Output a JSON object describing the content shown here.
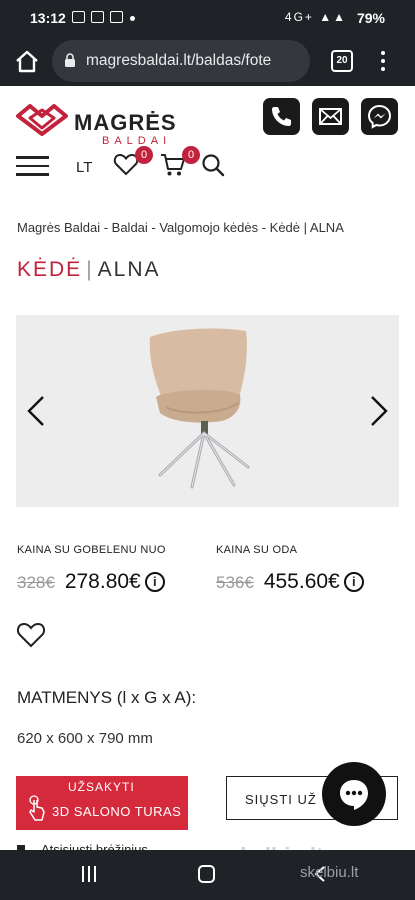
{
  "status_bar": {
    "time": "13:12",
    "battery": "79%",
    "signal": "4G+"
  },
  "browser": {
    "url": "magresbaldai.lt/baldas/fote",
    "tab_count": "20"
  },
  "header": {
    "brand": "MAGRĖS",
    "brand_sub": "BALDAI",
    "language": "LT",
    "wishlist_count": "0",
    "cart_count": "0",
    "icons": [
      "phone-icon",
      "mail-icon",
      "messenger-icon",
      "menu-icon",
      "heart-icon",
      "cart-icon",
      "search-icon"
    ]
  },
  "breadcrumb": "Magrės Baldai - Baldai - Valgomojo kėdės - Kėdė | ALNA",
  "product": {
    "title_part1": "KĖDĖ",
    "title_sep": "|",
    "title_part2": "ALNA"
  },
  "prices": [
    {
      "label": "KAINA SU GOBELENU NUO",
      "old": "328€",
      "new": "278.80€"
    },
    {
      "label": "KAINA SU ODA",
      "old": "536€",
      "new": "455.60€"
    }
  ],
  "dimensions": {
    "title": "MATMENYS (l x G x A):",
    "value": "620 x 600 x 790 mm"
  },
  "actions": {
    "order_label": "UŽSAKYTI",
    "tour_label": "3D SALONO TURAS",
    "send_label": "SIŲSTI UŽ"
  },
  "below_text": "Atsisiųsti brėžinius",
  "watermark": "skelbiu.lt",
  "colors": {
    "accent": "#c2223b",
    "button_red": "#d42a3c",
    "dark": "#1f2226"
  }
}
